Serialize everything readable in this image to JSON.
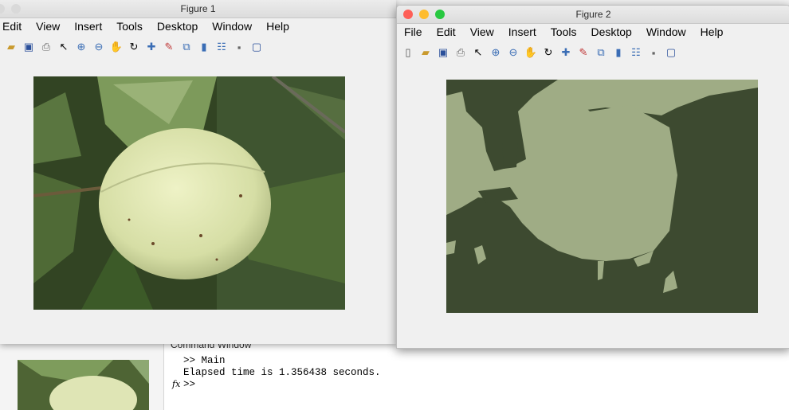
{
  "figure1": {
    "title": "Figure 1",
    "menu": [
      "Edit",
      "View",
      "Insert",
      "Tools",
      "Desktop",
      "Window",
      "Help"
    ]
  },
  "figure2": {
    "title": "Figure 2",
    "menu": [
      "File",
      "Edit",
      "View",
      "Insert",
      "Tools",
      "Desktop",
      "Window",
      "Help"
    ]
  },
  "toolbar_icons": [
    "new-icon",
    "open-icon",
    "save-icon",
    "print-icon",
    "pointer-icon",
    "zoom-in-icon",
    "zoom-out-icon",
    "pan-icon",
    "rotate-icon",
    "datacursor-icon",
    "brush-icon",
    "link-icon",
    "colorbar-icon",
    "legend-icon",
    "hide-icon",
    "show-icon"
  ],
  "command_window": {
    "title": "Command Window",
    "lines": [
      ">> Main",
      "Elapsed time is 1.356438 seconds.",
      ">>"
    ]
  },
  "colors": {
    "segment_dark": "#3d4a30",
    "segment_light": "#9fac85",
    "leaf": "#7a9a5a",
    "fruit": "#dfe6b4"
  }
}
